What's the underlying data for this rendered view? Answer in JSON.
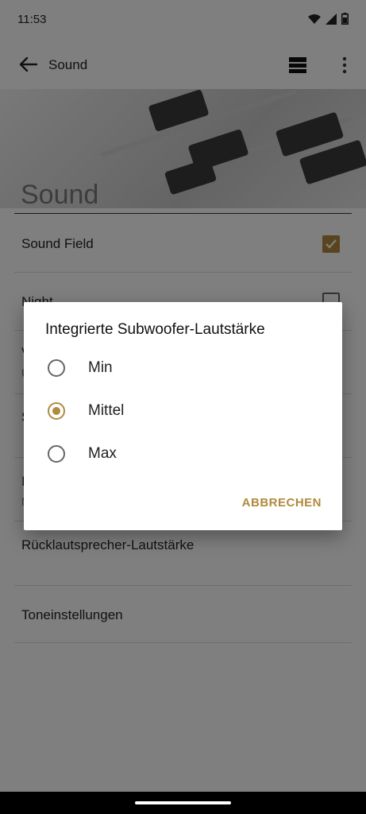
{
  "status": {
    "time": "11:53"
  },
  "appbar": {
    "title": "Sound"
  },
  "section": {
    "title": "Sound"
  },
  "rows": [
    {
      "label": "Sound Field",
      "checked": true
    },
    {
      "label": "Night",
      "checked": false
    },
    {
      "label": "V",
      "sub": "U"
    },
    {
      "label": "S"
    },
    {
      "label": "I",
      "sub": "N"
    },
    {
      "label": "Rücklautsprecher-Lautstärke"
    },
    {
      "label": "Toneinstellungen"
    }
  ],
  "dialog": {
    "title": "Integrierte Subwoofer-Lautstärke",
    "options": [
      {
        "label": "Min",
        "selected": false
      },
      {
        "label": "Mittel",
        "selected": true
      },
      {
        "label": "Max",
        "selected": false
      }
    ],
    "cancel_label": "ABBRECHEN"
  },
  "colors": {
    "accent": "#b08a3e"
  }
}
